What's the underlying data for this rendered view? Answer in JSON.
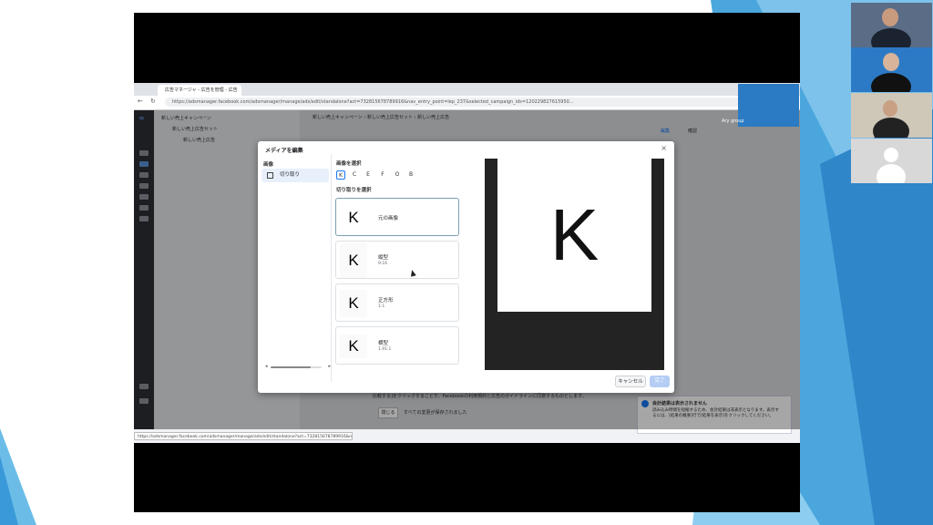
{
  "browser": {
    "tab_title": "広告マネージャ - 広告を管理 - 広告",
    "url": "https://adsmanager.facebook.com/adsmanager/manage/ads/edit/standalone?act=732815678789916&nav_entry_point=lep_237&selected_campaign_ids=120229827615950...",
    "status_url": "https://adsmanager.facebook.com/adsmanager/manage/ads/edit/standalone?act=732815678789916&nav_entry_po..."
  },
  "campaign_nav": {
    "campaign": "新しい売上キャンペーン",
    "adset": "新しい売上広告セット",
    "ad": "新しい売上広告"
  },
  "breadcrumbs": [
    "新しい売上キャンペーン",
    "新しい売上広告セット",
    "新しい売上広告"
  ],
  "toolbar": {
    "edit": "編集",
    "review": "確認"
  },
  "modal": {
    "title": "メディアを編集",
    "close": "×",
    "side_section": "画像",
    "side_item": "切り取り",
    "select_image_label": "画像を選択",
    "image_options": [
      "K",
      "C",
      "E",
      "F",
      "O",
      "B"
    ],
    "select_crop_label": "切り取りを選択",
    "crops": [
      {
        "thumb": "K",
        "name": "元の画像",
        "ratio": ""
      },
      {
        "thumb": "K",
        "name": "縦型",
        "ratio": "9:16"
      },
      {
        "thumb": "K",
        "name": "正方形",
        "ratio": "1:1"
      },
      {
        "thumb": "K",
        "name": "横型",
        "ratio": "1.91:1"
      }
    ],
    "preview_letter": "K",
    "cancel": "キャンセル",
    "done": "完了"
  },
  "bottom_notice": {
    "line1": "比較する]をクリックすることで、Facebookの利用規約と広告のガイドラインに同意するものとします。",
    "close_button": "閉じる",
    "status": "すべての変更が保存されました"
  },
  "toast": {
    "title": "会計結果は表示されません",
    "body": "読み込み時間を短縮するため、会計結果は非表示となります。表示するには、[結果の概要]行で[結果を表示]をクリックしてください。"
  },
  "meeting": {
    "tile_label": "Ary group"
  },
  "colors": {
    "accent": "#1877f2",
    "modal_bg": "#ffffff",
    "preview_bg": "#232323",
    "slide_bg_blue": "#3aa0e0"
  }
}
